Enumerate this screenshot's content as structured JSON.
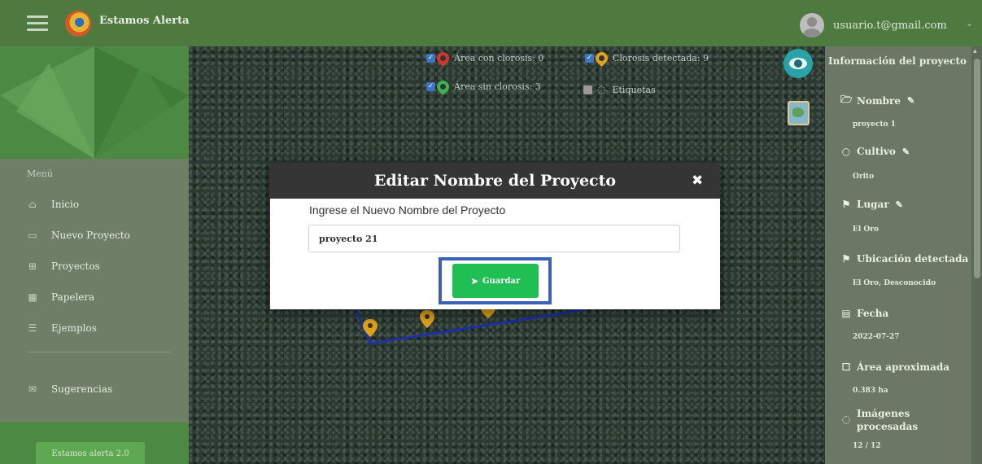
{
  "header": {
    "app_title": "Estamos Alerta",
    "user_email": "usuario.t@gmail.com"
  },
  "sidebar": {
    "menu_heading": "Menú",
    "items": [
      {
        "label": "Inicio",
        "icon": "home-icon"
      },
      {
        "label": "Nuevo Proyecto",
        "icon": "new-project-icon"
      },
      {
        "label": "Proyectos",
        "icon": "grid-icon"
      },
      {
        "label": "Papelera",
        "icon": "trash-grid-icon"
      },
      {
        "label": "Ejemplos",
        "icon": "list-icon"
      }
    ],
    "suggestions_label": "Sugerencias",
    "bottom_button": "Estamos alerta 2.0"
  },
  "map": {
    "legend": {
      "chlorosis_area": "Área con clorosis: 0",
      "chlorosis_detected": "Clorosis detectada: 9",
      "no_chlorosis_area": "Área sin clorosis: 3",
      "labels": "Etiquetas"
    },
    "colors": {
      "chlorosis_pin": "#d9342b",
      "detected_pin": "#e3a21a",
      "no_chlorosis_pin": "#3fb34f",
      "polygon": "#1f2fa8"
    }
  },
  "info_panel": {
    "title": "Información del proyecto",
    "fields": [
      {
        "label": "Nombre",
        "value": "proyecto 1",
        "icon": "folder-icon",
        "editable": true
      },
      {
        "label": "Cultivo",
        "value": "Orito",
        "icon": "circle-icon",
        "editable": true
      },
      {
        "label": "Lugar",
        "value": "El Oro",
        "icon": "location-pin-icon",
        "editable": true
      },
      {
        "label": "Ubicación detectada",
        "value": "El Oro, Desconocido",
        "icon": "location-pin-icon",
        "editable": false
      },
      {
        "label": "Fecha",
        "value": "2022-07-27",
        "icon": "calendar-icon",
        "editable": false
      },
      {
        "label": "Área aproximada",
        "value": "0.383 ha",
        "icon": "square-icon",
        "editable": false
      },
      {
        "label": "Imágenes procesadas",
        "value": "12 / 12",
        "icon": "spinner-icon",
        "editable": false
      }
    ]
  },
  "modal": {
    "title": "Editar Nombre del Proyecto",
    "close_symbol": "✖",
    "input_label": "Ingrese el Nuevo Nombre del Proyecto",
    "input_value": "proyecto 21",
    "save_label": "Guardar"
  }
}
